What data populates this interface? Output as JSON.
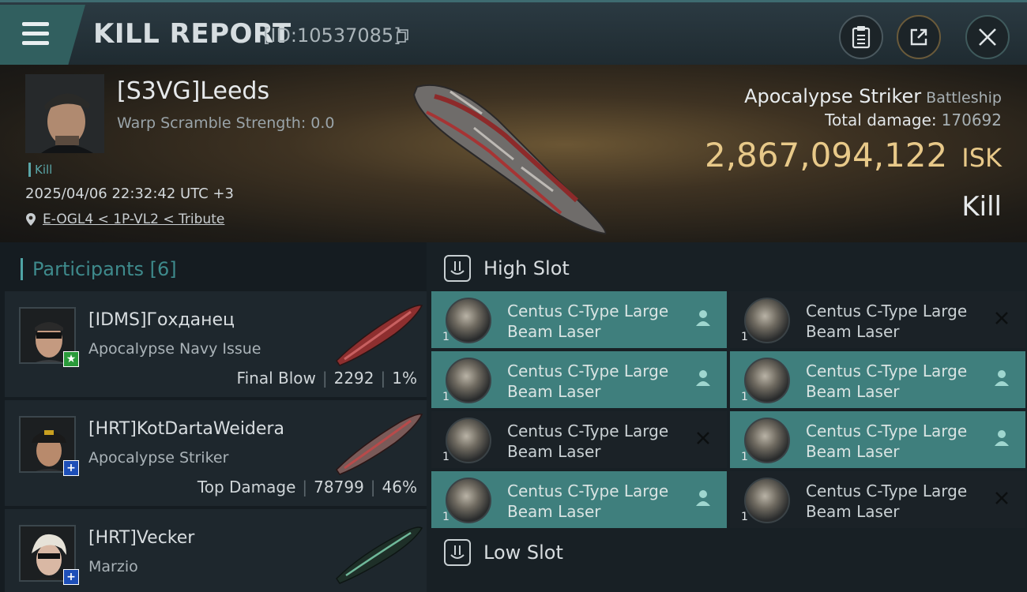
{
  "header": {
    "title": "KILL REPORT",
    "report_id": "[ID:10537085]"
  },
  "victim": {
    "name": "[S3VG]Leeds",
    "warp_scramble": "Warp Scramble Strength: 0.0",
    "tag": "Kill",
    "datetime": "2025/04/06 22:32:42 UTC +3",
    "location": "E-OGL4 < 1P-VL2 < Tribute",
    "ship_name": "Apocalypse Striker",
    "ship_class": "Battleship",
    "total_damage_label": "Total damage:",
    "total_damage": "170692",
    "isk_value": "2,867,094,122",
    "isk_unit": "ISK",
    "outcome": "Kill"
  },
  "participants": {
    "title": "Participants [6]",
    "rows": [
      {
        "name": "[IDMS]Гохданец",
        "ship": "Apocalypse Navy Issue",
        "stat_label": "Final Blow",
        "damage": "2292",
        "percent": "1%",
        "badge": "★",
        "badge_color": "#2a9a3a"
      },
      {
        "name": "[HRT]KotDartaWeidera",
        "ship": "Apocalypse Striker",
        "stat_label": "Top Damage",
        "damage": "78799",
        "percent": "46%",
        "badge": "+",
        "badge_color": "#1e4fb8"
      },
      {
        "name": "[HRT]Vecker",
        "ship": "Marzio",
        "stat_label": "",
        "damage": "",
        "percent": "",
        "badge": "+",
        "badge_color": "#1e4fb8"
      }
    ]
  },
  "slots": {
    "high_slot_label": "High Slot",
    "low_slot_label": "Low Slot",
    "high_modules": [
      {
        "name": "Centus C-Type Large Beam Laser",
        "qty": "1",
        "state": "dropped"
      },
      {
        "name": "Centus C-Type Large Beam Laser",
        "qty": "1",
        "state": "destroyed"
      },
      {
        "name": "Centus C-Type Large Beam Laser",
        "qty": "1",
        "state": "dropped"
      },
      {
        "name": "Centus C-Type Large Beam Laser",
        "qty": "1",
        "state": "dropped"
      },
      {
        "name": "Centus C-Type Large Beam Laser",
        "qty": "1",
        "state": "destroyed"
      },
      {
        "name": "Centus C-Type Large Beam Laser",
        "qty": "1",
        "state": "dropped"
      },
      {
        "name": "Centus C-Type Large Beam Laser",
        "qty": "1",
        "state": "dropped"
      },
      {
        "name": "Centus C-Type Large Beam Laser",
        "qty": "1",
        "state": "destroyed"
      }
    ]
  },
  "icons": {
    "menu": "hamburger-icon",
    "copy": "copy-icon",
    "clipboard": "clipboard-icon",
    "share": "share-icon",
    "close": "close-icon",
    "location": "location-pin-icon",
    "slot": "slot-icon",
    "dropped": "person-icon",
    "destroyed": "x-icon"
  },
  "colors": {
    "accent": "#4fa4a6",
    "isk": "#e8c989",
    "dropped_bg": "#3f7f7d",
    "destroyed_bg": "#1b2227"
  }
}
